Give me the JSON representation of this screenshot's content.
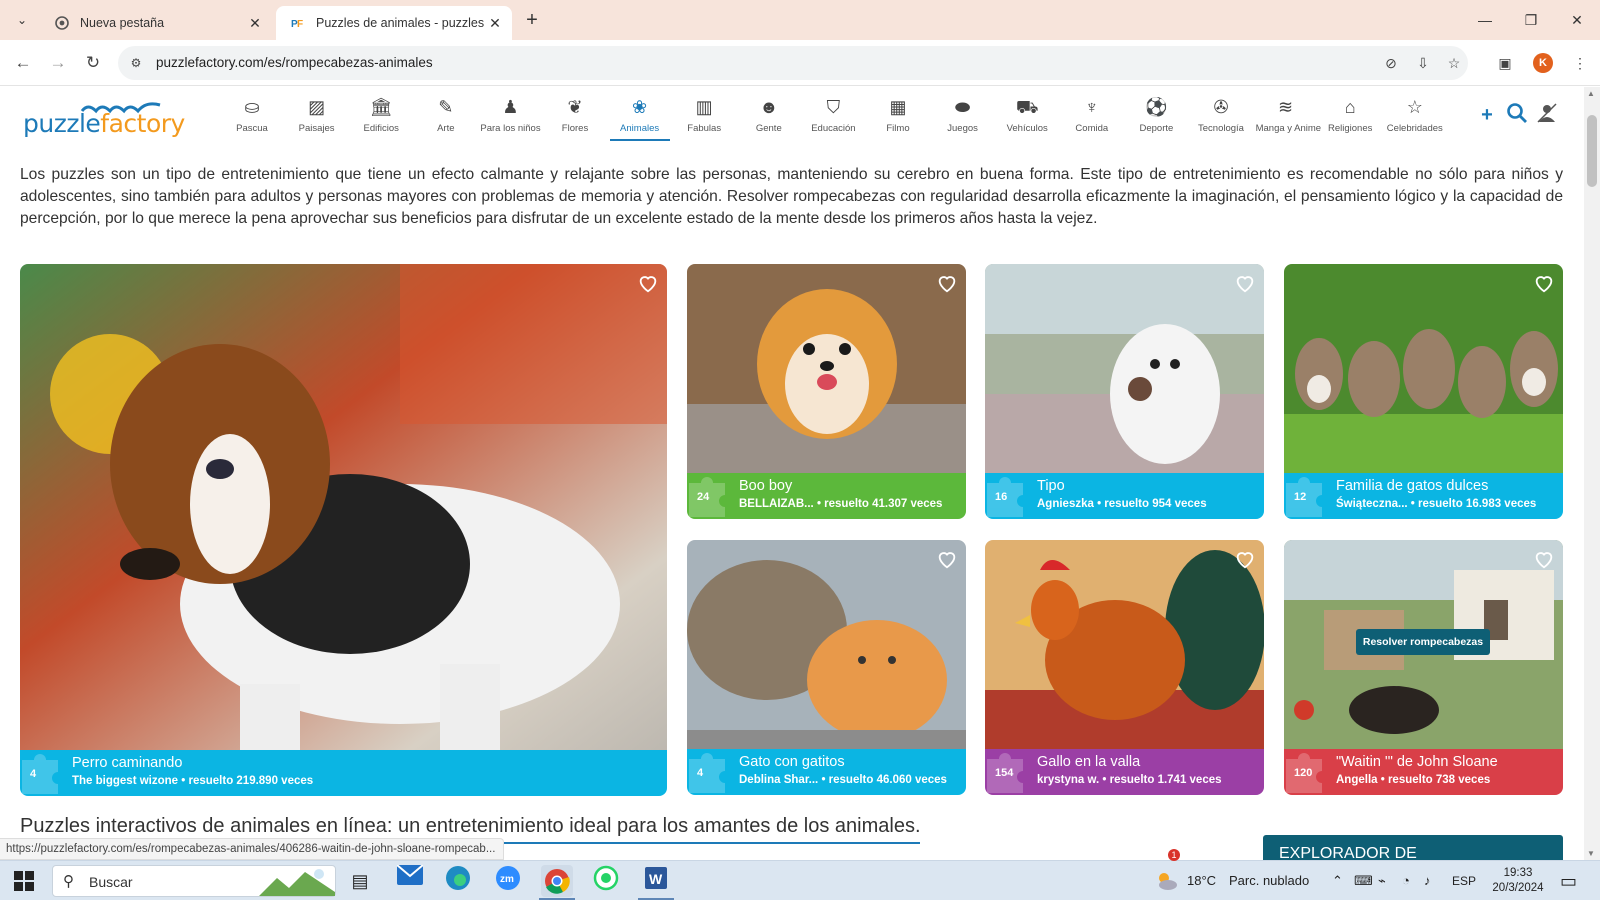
{
  "browser": {
    "tabs": [
      {
        "title": "Nueva pestaña",
        "close": "✕"
      },
      {
        "title": "Puzzles de animales - puzzles o",
        "close": "✕"
      }
    ],
    "newtab": "+",
    "url": "puzzlefactory.com/es/rompecabezas-animales",
    "profile_initial": "K",
    "window": {
      "min": "—",
      "max": "❐",
      "close": "✕"
    }
  },
  "site": {
    "logo": {
      "part1": "puzzle",
      "part2": "factory"
    },
    "categories": [
      {
        "label": "Pascua",
        "icon": "basket-icon"
      },
      {
        "label": "Paisajes",
        "icon": "landscape-icon"
      },
      {
        "label": "Edificios",
        "icon": "building-icon"
      },
      {
        "label": "Arte",
        "icon": "brush-icon"
      },
      {
        "label": "Para los niños",
        "icon": "child-icon"
      },
      {
        "label": "Flores",
        "icon": "leaf-icon"
      },
      {
        "label": "Animales",
        "icon": "paw-icon"
      },
      {
        "label": "Fabulas",
        "icon": "book-icon"
      },
      {
        "label": "Gente",
        "icon": "people-icon"
      },
      {
        "label": "Educación",
        "icon": "graduation-icon"
      },
      {
        "label": "Filmo",
        "icon": "film-icon"
      },
      {
        "label": "Juegos",
        "icon": "gamepad-icon"
      },
      {
        "label": "Vehículos",
        "icon": "car-icon"
      },
      {
        "label": "Comida",
        "icon": "cutlery-icon"
      },
      {
        "label": "Deporte",
        "icon": "ball-icon"
      },
      {
        "label": "Tecnología",
        "icon": "wrench-icon"
      },
      {
        "label": "Manga y Anime",
        "icon": "wave-icon"
      },
      {
        "label": "Religiones",
        "icon": "temple-icon"
      },
      {
        "label": "Celebridades",
        "icon": "star-icon"
      }
    ],
    "active_category": "Animales",
    "intro": "Los puzzles son un tipo de entretenimiento que tiene un efecto calmante y relajante sobre las personas, manteniendo su cerebro en buena forma. Este tipo de entretenimiento es recomendable no sólo para niños y adolescentes, sino también para adultos y personas mayores con problemas de memoria y atención. Resolver rompecabezas con regularidad desarrolla eficazmente la imaginación, el pensamiento lógico y la capacidad de percepción, por lo que merece la pena aprovechar sus beneficios para disfrutar de un excelente estado de la mente desde los primeros años hasta la vejez.",
    "puzzles": [
      {
        "pieces": "4",
        "name": "Perro caminando",
        "meta": "The biggest wizone • resuelto 219.890 veces",
        "color": "#0bb5e3"
      },
      {
        "pieces": "24",
        "name": "Boo boy",
        "meta": "BELLAIZAB... • resuelto 41.307 veces",
        "color": "#5cb83b"
      },
      {
        "pieces": "16",
        "name": "Tipo",
        "meta": "Agnieszka • resuelto 954 veces",
        "color": "#0bb5e3"
      },
      {
        "pieces": "12",
        "name": "Familia de gatos dulces",
        "meta": "Świąteczna... • resuelto 16.983 veces",
        "color": "#0bb5e3"
      },
      {
        "pieces": "4",
        "name": "Gato con gatitos",
        "meta": "Deblina Shar... • resuelto 46.060 veces",
        "color": "#0bb5e3"
      },
      {
        "pieces": "154",
        "name": "Gallo en la valla",
        "meta": "krystyna w. • resuelto 1.741 veces",
        "color": "#9b3fa5"
      },
      {
        "pieces": "120",
        "name": "\"Waitin '\" de John Sloane",
        "meta": "Angella • resuelto 738 veces",
        "color": "#d93f48"
      }
    ],
    "solve_button": "Resolver rompecabezas",
    "subheading": "Puzzles interactivos de animales en línea: un entretenimiento ideal para los amantes de los animales.",
    "explorer": "EXPLORADOR DE",
    "status_url": "https://puzzlefactory.com/es/rompecabezas-animales/406286-waitin-de-john-sloane-rompecab..."
  },
  "taskbar": {
    "search": "Buscar",
    "weather_temp": "18°C",
    "weather_text": "Parc. nublado",
    "weather_badge": "1",
    "lang": "ESP",
    "time": "19:33",
    "date": "20/3/2024"
  }
}
